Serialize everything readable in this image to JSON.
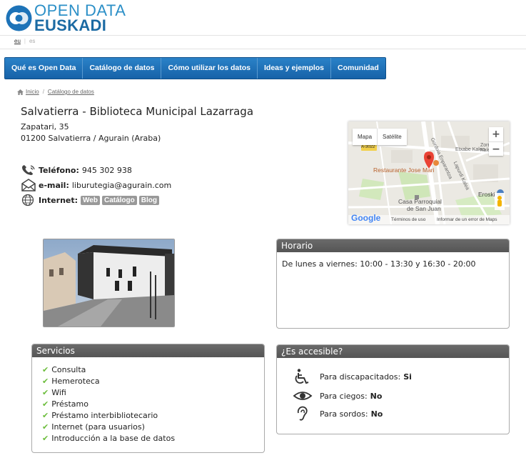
{
  "brand": {
    "line1": "OPEN DATA",
    "line2": "EUSKADI"
  },
  "lang": {
    "eu": "eu",
    "es": "es"
  },
  "nav": [
    "Qué es Open Data",
    "Catálogo de datos",
    "Cómo utilizar los datos",
    "Ideas y ejemplos",
    "Comunidad"
  ],
  "breadcrumb": {
    "home": "Inicio",
    "current": "Catálogo de datos"
  },
  "title": "Salvatierra - Biblioteca Municipal Lazarraga",
  "address": {
    "line1": "Zapatari, 35",
    "line2": "01200 Salvatierra / Agurain (Araba)"
  },
  "contact": {
    "phone_label": "Teléfono:",
    "phone": "945 302 938",
    "email_label": "e-mail:",
    "email": "liburutegia@agurain.com",
    "web_label": "Internet:",
    "links": [
      "Web",
      "Catálogo",
      "Blog"
    ]
  },
  "map": {
    "type_map": "Mapa",
    "type_sat": "Satélite",
    "zoom_in": "+",
    "zoom_out": "−",
    "poi_restaurant": "Restaurante Jose Mari",
    "poi_church_1": "Casa Parroquial",
    "poi_church_2": "de San Juan",
    "street_1": "Etxabe Kalea",
    "street_2": "Gordoia Enparantza",
    "street_3": "Lapurdi Kalea",
    "poi_store": "Eroski",
    "street_4": "Zorrobi Kalea",
    "road": "A-3022",
    "google": "Google",
    "terms": "Términos de uso",
    "report": "Informar de un error de Maps"
  },
  "horario": {
    "title": "Horario",
    "text": "De lunes a viernes: 10:00 - 13:30 y 16:30 - 20:00"
  },
  "servicios": {
    "title": "Servicios",
    "items": [
      "Consulta",
      "Hemeroteca",
      "Wifi",
      "Préstamo",
      "Préstamo interbibliotecario",
      "Internet (para usuarios)",
      "Introducción a la base de datos"
    ]
  },
  "accesible": {
    "title": "¿Es accesible?",
    "rows": [
      {
        "label": "Para discapacitados:",
        "value": "Si"
      },
      {
        "label": "Para ciegos:",
        "value": "No"
      },
      {
        "label": "Para sordos:",
        "value": "No"
      }
    ]
  },
  "colors": {
    "nav": "#1d70b5",
    "brand_blue": "#2b8fc7",
    "panel_head": "#5f5f5f",
    "check": "#6cbd3c"
  }
}
